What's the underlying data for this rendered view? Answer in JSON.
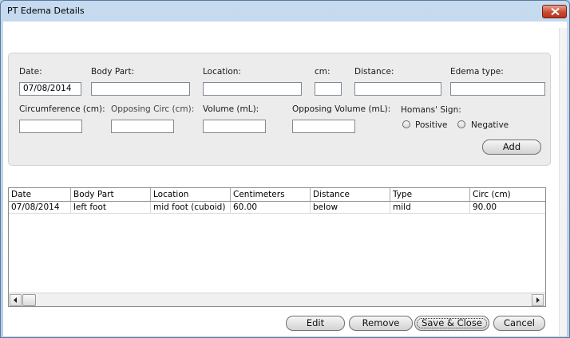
{
  "window": {
    "title": "PT Edema Details"
  },
  "form": {
    "date": {
      "label": "Date:",
      "value": "07/08/2014"
    },
    "body_part": {
      "label": "Body Part:",
      "value": ""
    },
    "location": {
      "label": "Location:",
      "value": ""
    },
    "cm": {
      "label": "cm:",
      "value": ""
    },
    "distance": {
      "label": "Distance:",
      "value": ""
    },
    "edema_type": {
      "label": "Edema type:",
      "value": ""
    },
    "circumference": {
      "label": "Circumference (cm):",
      "value": ""
    },
    "opposing_circ": {
      "label": "Opposing Circ (cm):",
      "value": ""
    },
    "volume": {
      "label": "Volume (mL):",
      "value": ""
    },
    "opposing_volume": {
      "label": "Opposing Volume (mL):",
      "value": ""
    },
    "homans": {
      "label": "Homans' Sign:",
      "options": [
        "Positive",
        "Negative"
      ],
      "selected": null
    },
    "add_label": "Add"
  },
  "table": {
    "columns": [
      "Date",
      "Body Part",
      "Location",
      "Centimeters",
      "Distance",
      "Type",
      "Circ (cm)"
    ],
    "rows": [
      [
        "07/08/2014",
        "left foot",
        "mid foot (cuboid)",
        "60.00",
        "below",
        "mild",
        "90.00"
      ]
    ]
  },
  "footer": {
    "edit_label": "Edit",
    "remove_label": "Remove",
    "save_close_label": "Save & Close",
    "cancel_label": "Cancel"
  },
  "icons": {
    "close": "close-icon",
    "scroll_left": "chevron-left-icon",
    "scroll_right": "chevron-right-icon"
  },
  "colors": {
    "title_bar": "#c6dbef",
    "close_button": "#c94b32",
    "panel": "#ececec"
  }
}
